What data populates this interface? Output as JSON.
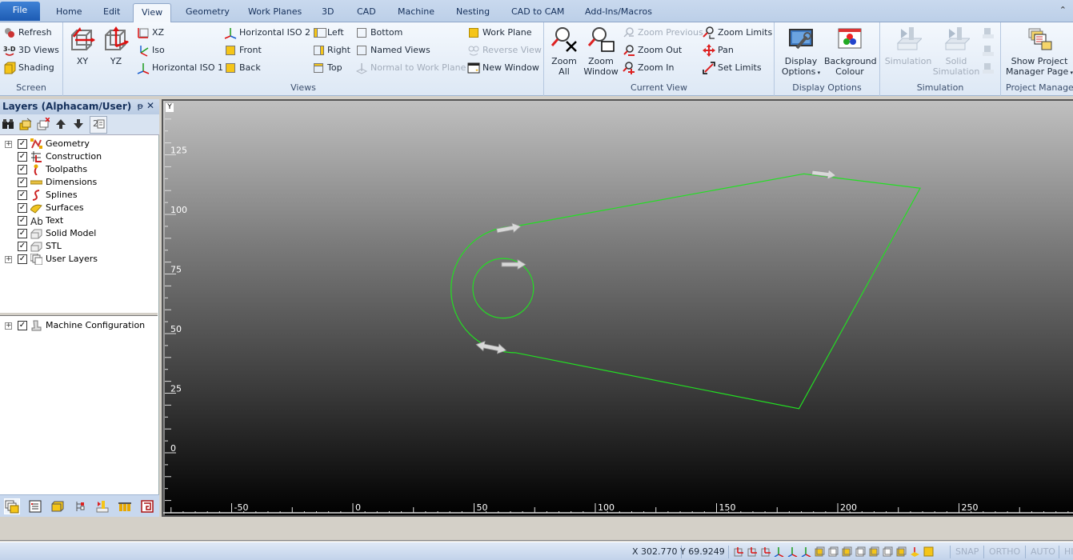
{
  "ribbon": {
    "tabs": [
      {
        "label": "File"
      },
      {
        "label": "Home"
      },
      {
        "label": "Edit"
      },
      {
        "label": "View",
        "active": true
      },
      {
        "label": "Geometry"
      },
      {
        "label": "Work Planes"
      },
      {
        "label": "3D"
      },
      {
        "label": "CAD"
      },
      {
        "label": "Machine"
      },
      {
        "label": "Nesting"
      },
      {
        "label": "CAD to CAM"
      },
      {
        "label": "Add-Ins/Macros"
      }
    ],
    "groups": {
      "screen": {
        "label": "Screen",
        "refresh": "Refresh",
        "views3d": "3D Views",
        "shading": "Shading"
      },
      "views": {
        "label": "Views",
        "xy": "XY",
        "yz": "YZ",
        "xz": "XZ",
        "iso": "Iso",
        "hiso1": "Horizontal ISO 1",
        "hiso2": "Horizontal ISO 2",
        "front": "Front",
        "back": "Back",
        "left": "Left",
        "right": "Right",
        "top": "Top",
        "bottom": "Bottom",
        "named_views": "Named Views",
        "normal_to_wp": "Normal to Work Plane",
        "work_plane": "Work Plane",
        "reverse_view": "Reverse View",
        "new_window": "New Window"
      },
      "current_view": {
        "label": "Current View",
        "zoom_all_1": "Zoom",
        "zoom_all_2": "All",
        "zoom_window_1": "Zoom",
        "zoom_window_2": "Window",
        "zoom_previous": "Zoom Previous",
        "zoom_out": "Zoom Out",
        "zoom_in": "Zoom In",
        "zoom_limits": "Zoom Limits",
        "pan": "Pan",
        "set_limits": "Set Limits"
      },
      "display_options": {
        "label": "Display Options",
        "display_1": "Display",
        "display_2": "Options",
        "bg_1": "Background",
        "bg_2": "Colour"
      },
      "simulation": {
        "label": "Simulation",
        "simulation": "Simulation",
        "solid_1": "Solid",
        "solid_2": "Simulation"
      },
      "project_manager": {
        "label": "Project Manager",
        "show_1": "Show Project",
        "show_2": "Manager Page"
      }
    }
  },
  "layers_panel": {
    "title": "Layers (Alphacam/User)",
    "pin": "ᵽ",
    "close": "✕",
    "items": [
      {
        "label": "Geometry",
        "checked": true,
        "expandable": true
      },
      {
        "label": "Construction",
        "checked": true,
        "expandable": false
      },
      {
        "label": "Toolpaths",
        "checked": true,
        "expandable": false
      },
      {
        "label": "Dimensions",
        "checked": true,
        "expandable": false
      },
      {
        "label": "Splines",
        "checked": true,
        "expandable": false
      },
      {
        "label": "Surfaces",
        "checked": true,
        "expandable": false
      },
      {
        "label": "Text",
        "checked": true,
        "expandable": false
      },
      {
        "label": "Solid Model",
        "checked": true,
        "expandable": false
      },
      {
        "label": "STL",
        "checked": true,
        "expandable": false
      },
      {
        "label": "User Layers",
        "checked": true,
        "expandable": true
      }
    ],
    "machine_items": [
      {
        "label": "Machine Configuration",
        "checked": true,
        "expandable": true
      }
    ]
  },
  "viewport": {
    "y_axis_label": "Y",
    "x_ticks": [
      -50,
      0,
      50,
      100,
      150,
      200,
      250
    ],
    "y_ticks": [
      0,
      25,
      50,
      75,
      100,
      125
    ],
    "geometry_color": "#22e022",
    "geometry": {
      "hole": {
        "cx": 62,
        "cy": 69,
        "r": 12.5
      },
      "outline": {
        "arc_center": [
          62,
          69
        ],
        "arc_radius": 26.5,
        "top_tangent": [
          67,
          95
        ],
        "top_right_peak": [
          186,
          117
        ],
        "right_corner": [
          234,
          111
        ],
        "bottom_corner": [
          184,
          18.5
        ],
        "bottom_tangent": [
          67,
          42
        ]
      },
      "direction_arrows": [
        {
          "at": [
            64,
            94
          ],
          "dir": "right"
        },
        {
          "at": [
            194,
            117
          ],
          "dir": "right"
        },
        {
          "at": [
            66,
            79
          ],
          "dir": "right"
        },
        {
          "at": [
            58,
            44
          ],
          "dir": "both"
        }
      ]
    }
  },
  "statusbar": {
    "x_readout": "X 302.770",
    "y_readout": "Y 69.9249",
    "snap": "SNAP",
    "ortho": "ORTHO",
    "auto": "AUTO",
    "hi": "HI"
  }
}
